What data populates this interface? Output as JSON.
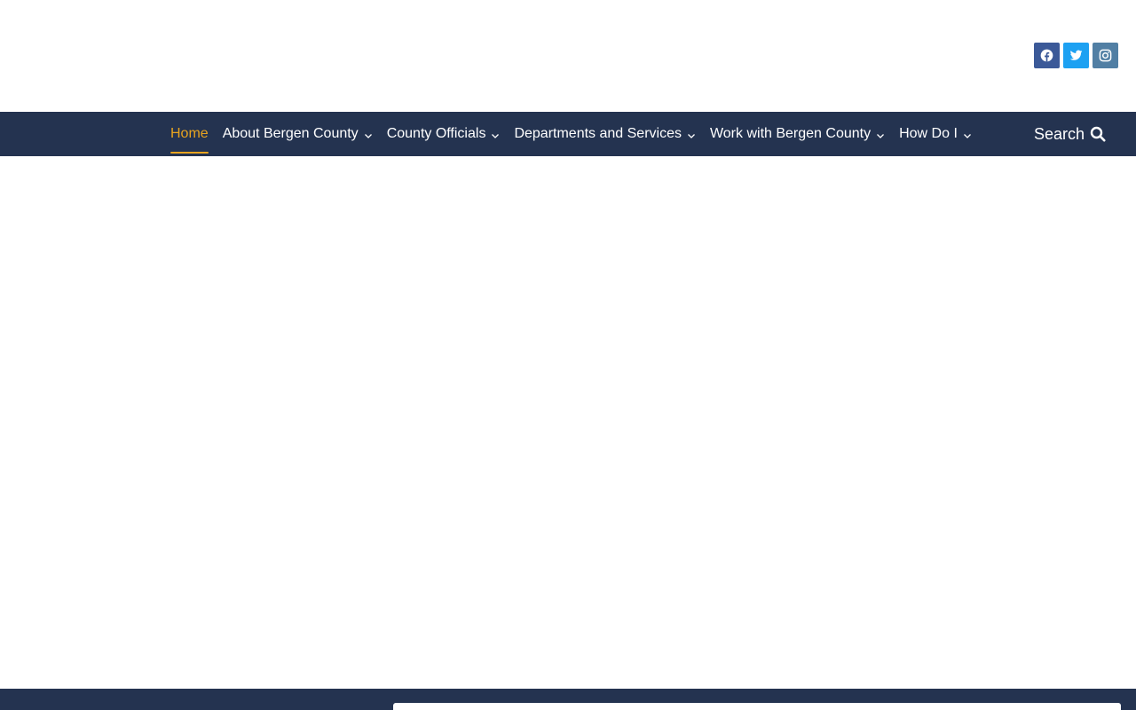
{
  "header": {
    "social": [
      {
        "icon": "facebook-icon",
        "color": "#3b5998"
      },
      {
        "icon": "twitter-icon",
        "color": "#1da1f2"
      },
      {
        "icon": "instagram-icon",
        "color": "#517fa4"
      }
    ]
  },
  "nav": {
    "items": [
      {
        "label": "Home",
        "active": true,
        "has_dropdown": false
      },
      {
        "label": "About Bergen County",
        "has_dropdown": true
      },
      {
        "label": "County Officials",
        "has_dropdown": true
      },
      {
        "label": "Departments and Services",
        "has_dropdown": true
      },
      {
        "label": "Work with Bergen County",
        "has_dropdown": true
      },
      {
        "label": "How Do I",
        "has_dropdown": true
      }
    ],
    "search_label": "Search",
    "colors": {
      "background": "#243350",
      "text": "#ffffff",
      "active": "#e8a41f"
    }
  }
}
